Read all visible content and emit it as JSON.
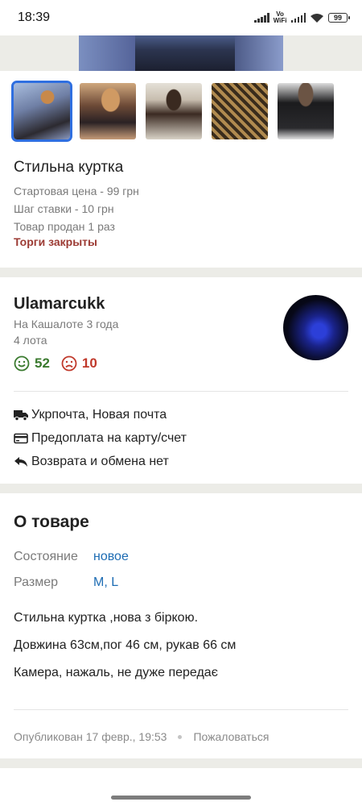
{
  "status_bar": {
    "time": "18:39",
    "vowifi": "Vo WiFi",
    "battery": "99"
  },
  "product": {
    "title": "Стильна куртка",
    "start_price": "Стартовая цена - 99 грн",
    "bid_step": "Шаг ставки - 10 грн",
    "sold_count": "Товар продан 1 раз",
    "auction_status": "Торги закрыты",
    "thumbnails": 5,
    "selected_thumbnail": 1
  },
  "seller": {
    "name": "Ulamarcukk",
    "membership": "На Кашалоте 3 года",
    "lots": "4 лота",
    "positive_reviews": "52",
    "negative_reviews": "10"
  },
  "delivery": {
    "shipping": "Укрпочта, Новая почта",
    "payment": "Предоплата на карту/счет",
    "returns": "Возврата и обмена нет"
  },
  "about": {
    "title": "О товаре",
    "condition_label": "Состояние",
    "condition_value": "новое",
    "size_label": "Размер",
    "size_value": "M, L",
    "description": [
      "Стильна куртка ,нова з біркою.",
      "Довжина 63см,пог 46 см, рукав 66 см",
      "Камера, нажаль, не дуже передає"
    ]
  },
  "footer": {
    "published": "Опубликован 17 февр., 19:53",
    "report": "Пожаловаться"
  },
  "colors": {
    "accent_blue": "#2f6fe0",
    "link_blue": "#1d6cb3",
    "closed_red": "#9c3b34",
    "positive_green": "#3a7a2e",
    "negative_red": "#c0392b",
    "separator": "#ecece7"
  }
}
